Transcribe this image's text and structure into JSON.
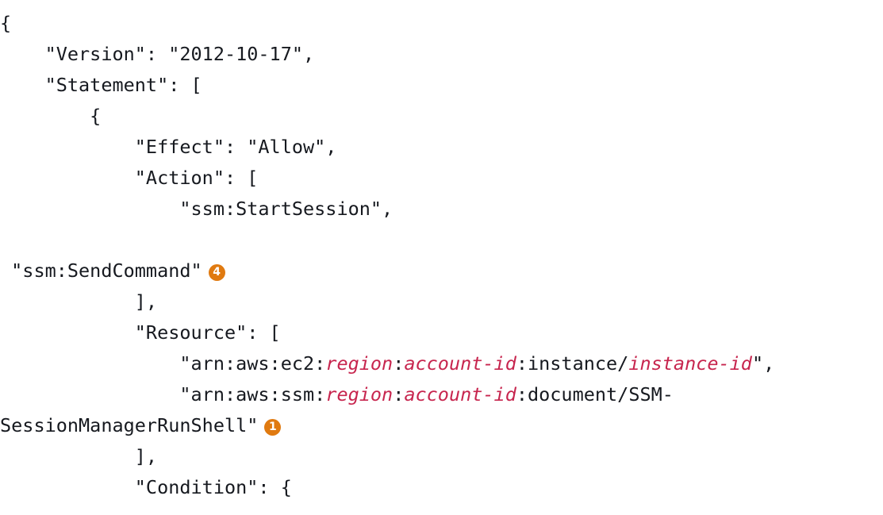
{
  "code": {
    "open_brace": "{",
    "version_line": "    \"Version\": \"2012-10-17\",",
    "statement_line": "    \"Statement\": [",
    "inner_open_brace": "        {",
    "effect_line": "            \"Effect\": \"Allow\",",
    "action_line": "            \"Action\": [",
    "start_session_line": "                \"ssm:StartSession\",",
    "send_command_line": " \"ssm:SendCommand\"",
    "action_close_line": "            ],",
    "resource_line": "            \"Resource\": [",
    "arn1": {
      "prefix": "                \"arn:aws:ec2:",
      "region": "region",
      "sep1": ":",
      "account": "account-id",
      "mid": ":instance/",
      "instance": "instance-id",
      "suffix": "\","
    },
    "arn2": {
      "prefix": "                \"arn:aws:ssm:",
      "region": "region",
      "sep1": ":",
      "account": "account-id",
      "suffix": ":document/SSM-"
    },
    "arn2_wrap": "SessionManagerRunShell\"",
    "resource_close_line": "            ],",
    "condition_line": "            \"Condition\": {"
  },
  "callouts": {
    "send_command": "4",
    "run_shell": "1"
  },
  "colors": {
    "variable": "#c7254e",
    "callout": "#e07a10"
  }
}
